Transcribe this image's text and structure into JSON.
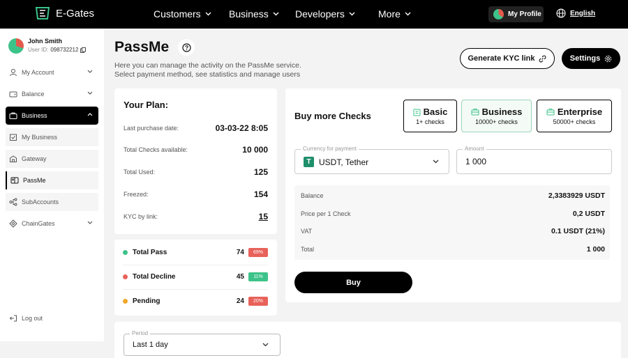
{
  "header": {
    "logo_text": "E-Gates",
    "nav": [
      {
        "label": "Customers"
      },
      {
        "label": "Business"
      },
      {
        "label": "Developers"
      },
      {
        "label": "More"
      }
    ],
    "profile_label": "My Profile",
    "language": "English"
  },
  "user": {
    "name": "John Smith",
    "id_label": "User ID:",
    "id_value": "098732212"
  },
  "sidebar": {
    "items": [
      {
        "label": "My Account",
        "icon": "user-icon"
      },
      {
        "label": "Balance",
        "icon": "wallet-icon"
      },
      {
        "label": "Business",
        "icon": "briefcase-icon"
      },
      {
        "label": "My Business",
        "icon": "store-icon"
      },
      {
        "label": "Gateway",
        "icon": "gateway-icon"
      },
      {
        "label": "PassMe",
        "icon": "passme-icon"
      },
      {
        "label": "SubAccounts",
        "icon": "subaccounts-icon"
      },
      {
        "label": "ChainGates",
        "icon": "chain-icon"
      }
    ],
    "logout": "Log out"
  },
  "page": {
    "title": "PassMe",
    "subtitle_line1": "Here you can manage the activity on the PassMe service.",
    "subtitle_line2": "Select payment method, see statistics and manage users",
    "kyc_button": "Generate KYC link",
    "settings_button": "Settings"
  },
  "plan": {
    "title": "Your Plan:",
    "rows": [
      {
        "label": "Last purchase date:",
        "value": "03-03-22 8:05"
      },
      {
        "label": "Total Checks available:",
        "value": "10 000"
      },
      {
        "label": "Total Used:",
        "value": "125"
      },
      {
        "label": "Freezed:",
        "value": "154"
      },
      {
        "label": "KYC by link:",
        "value": "15"
      }
    ]
  },
  "stats": [
    {
      "label": "Total Pass",
      "count": "74",
      "percent": "69%",
      "color": "#3cc38a",
      "badge_color": "#e8625a"
    },
    {
      "label": "Total Decline",
      "count": "45",
      "percent": "11%",
      "color": "#e8625a",
      "badge_color": "#3cc38a"
    },
    {
      "label": "Pending",
      "count": "24",
      "percent": "20%",
      "color": "#f0a92a",
      "badge_color": "#e8625a"
    }
  ],
  "buy": {
    "title": "Buy more Checks",
    "plans": [
      {
        "name": "Basic",
        "checks": "1+ checks"
      },
      {
        "name": "Business",
        "checks": "10000+ checks"
      },
      {
        "name": "Enterprise",
        "checks": "50000+ checks"
      }
    ],
    "currency_label": "Currency for payment",
    "currency_value": "USDT, Tether",
    "amount_label": "Amount",
    "amount_value": "1 000",
    "summary": [
      {
        "label": "Balance",
        "value": "2,3383929 USDT"
      },
      {
        "label": "Price per 1 Check",
        "value": "0,2 USDT"
      },
      {
        "label": "VAT",
        "value": "0.1 USDT (21%)"
      },
      {
        "label": "Total",
        "value": "1 000"
      }
    ],
    "buy_button": "Buy"
  },
  "period": {
    "label": "Period",
    "value": "Last 1 day"
  }
}
